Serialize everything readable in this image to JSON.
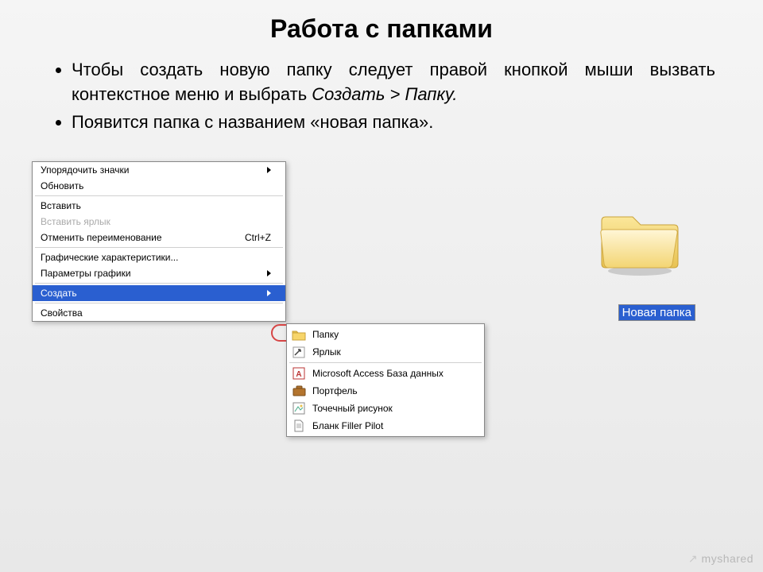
{
  "title": "Работа с папками",
  "bullet1_a": "Чтобы создать новую папку следует правой кнопкой мыши вызвать контекстное меню и выбрать ",
  "bullet1_b": "Создать > Папку.",
  "bullet2": "Появится папка с названием «новая папка».",
  "ctx": {
    "arrange": "Упорядочить значки",
    "refresh": "Обновить",
    "paste": "Вставить",
    "paste_shortcut": "Вставить ярлык",
    "undo": "Отменить переименование",
    "undo_key": "Ctrl+Z",
    "gfx_props": "Графические характеристики...",
    "gfx_params": "Параметры графики",
    "create": "Создать",
    "properties": "Свойства"
  },
  "submenu": {
    "folder": "Папку",
    "shortcut": "Ярлык",
    "access": "Microsoft Access База данных",
    "briefcase": "Портфель",
    "bitmap": "Точечный рисунок",
    "filler": "Бланк Filler Pilot"
  },
  "newfolder_label": "Новая папка",
  "watermark": "myshared"
}
